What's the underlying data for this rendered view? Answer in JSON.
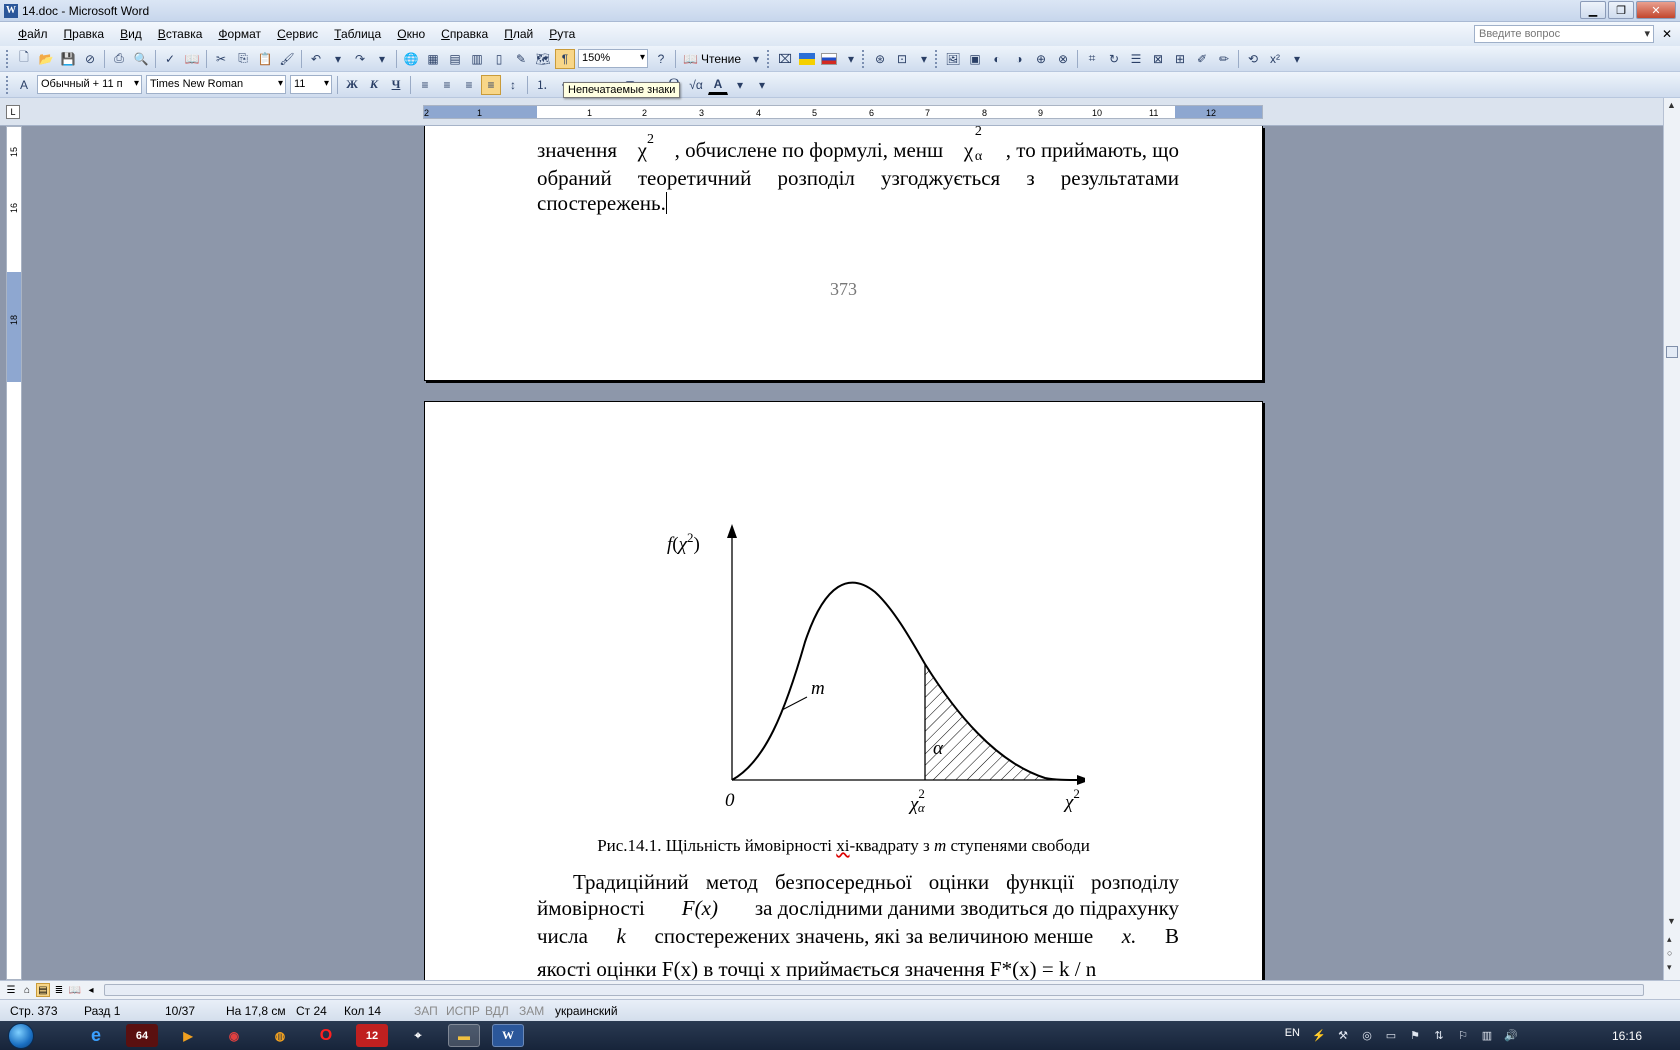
{
  "window": {
    "title": "14.doc - Microsoft Word"
  },
  "menu": {
    "items": [
      "Файл",
      "Правка",
      "Вид",
      "Вставка",
      "Формат",
      "Сервис",
      "Таблица",
      "Окно",
      "Справка",
      "Плай",
      "Рута"
    ],
    "ask_placeholder": "Введите вопрос"
  },
  "toolbar1": {
    "zoom": "150%",
    "read_label": "Чтение"
  },
  "toolbar2": {
    "style": "Обычный + 11 п",
    "font": "Times New Roman",
    "size": "11",
    "bold": "Ж",
    "italic": "К",
    "underline": "Ч"
  },
  "tooltip": "Непечатаемые знаки",
  "ruler": {
    "h_ticks": [
      "2",
      "1",
      "1",
      "2",
      "3",
      "4",
      "5",
      "6",
      "7",
      "8",
      "9",
      "10",
      "11",
      "12"
    ],
    "v_ticks": [
      "15",
      "16",
      "18"
    ]
  },
  "page1": {
    "line1_a": "значення",
    "chi": "χ",
    "sup2": "2",
    "line1_b": ", обчислене по формулі, менш",
    "sub_alpha": "α",
    "line1_c": ", то приймають, що",
    "line2": "обраний теоретичний розподіл узгоджується з результатами",
    "line3": "спостережень.",
    "page_number": "373"
  },
  "figure": {
    "y_axis_label_f": "f",
    "y_axis_label_open": "(",
    "chi_it": "χ",
    "close": ")",
    "curve_label": "m",
    "area_label": "α",
    "origin": "0",
    "caption_a": "Рис.14.1. Щільність ймовірності ",
    "caption_wavy": "хі",
    "caption_b": "-квадрату з ",
    "caption_m": "m",
    "caption_c": " ступенями свободи"
  },
  "page2": {
    "para_line1": "Традиційний метод безпосередньої оцінки функції розподілу",
    "para_line2_a": "ймовірності",
    "fx": "F(x)",
    "para_line2_b": "за дослідними даними зводиться до підрахунку",
    "para_line3_a": "числа",
    "k": "k",
    "para_line3_b": "спостережених значень, які за величиною менше",
    "x": "x.",
    "para_line3_c": "В",
    "para_line4": "якості оцінки F(x) в точці x приймається значення F*(x) = k / n"
  },
  "status": {
    "page": "Стр. 373",
    "section": "Разд 1",
    "pages": "10/37",
    "pos": "На 17,8 см",
    "line": "Ст 24",
    "col": "Кол 14",
    "rec": "ЗАП",
    "trk": "ИСПР",
    "ext": "ВДЛ",
    "ovr": "ЗАМ",
    "lang": "украинский"
  },
  "taskbar": {
    "lang": "EN",
    "time": "16:16",
    "badge1": "64",
    "badge2": "12"
  }
}
